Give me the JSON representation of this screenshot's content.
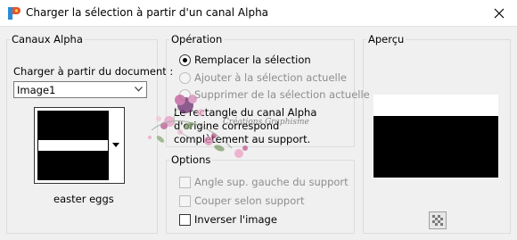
{
  "window": {
    "title": "Charger la sélection à partir d'un canal Alpha"
  },
  "channels": {
    "group_label": "Canaux Alpha",
    "load_from_label": "Charger à partir du document :",
    "document_value": "Image1",
    "channel_name": "easter eggs"
  },
  "operation": {
    "group_label": "Opération",
    "options": [
      {
        "label": "Remplacer la sélection",
        "selected": true,
        "enabled": true
      },
      {
        "label": "Ajouter à la sélection actuelle",
        "selected": false,
        "enabled": false
      },
      {
        "label": "Supprimer de la sélection actuelle",
        "selected": false,
        "enabled": false
      }
    ],
    "description_lines": [
      "Le rectangle du canal Alpha",
      "d'origine correspond",
      "complètement au support."
    ]
  },
  "options": {
    "group_label": "Options",
    "checkboxes": [
      {
        "label": "Angle sup. gauche du support",
        "checked": false,
        "enabled": false
      },
      {
        "label": "Couper selon support",
        "checked": false,
        "enabled": false
      },
      {
        "label": "Inverser l'image",
        "checked": false,
        "enabled": true
      }
    ]
  },
  "preview": {
    "group_label": "Aperçu"
  },
  "watermark": {
    "text": "Créations Graphisme"
  },
  "icons": {
    "app": "paint-palette-icon",
    "close": "close-icon",
    "proof": "checkerboard-icon"
  }
}
